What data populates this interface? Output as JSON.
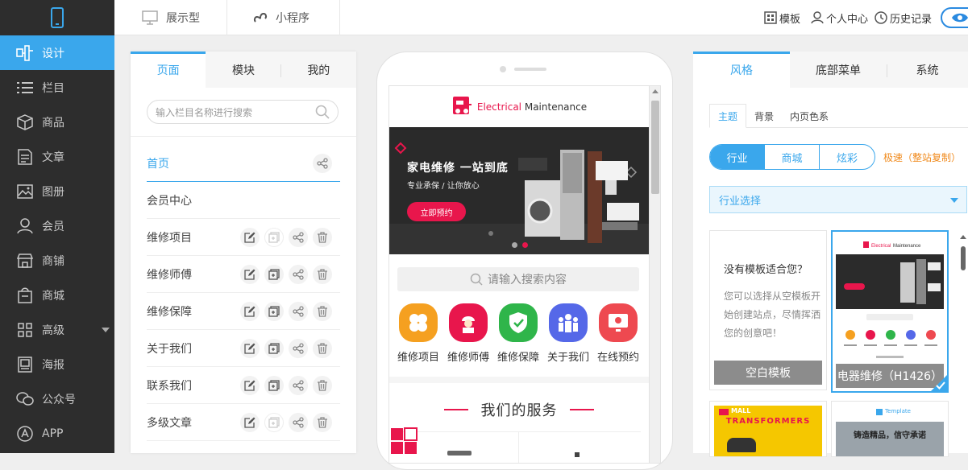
{
  "nav": {
    "items": [
      {
        "label": "设计",
        "icon": "design-icon",
        "active": true
      },
      {
        "label": "栏目",
        "icon": "list-icon"
      },
      {
        "label": "商品",
        "icon": "box-icon"
      },
      {
        "label": "文章",
        "icon": "article-icon"
      },
      {
        "label": "图册",
        "icon": "image-icon"
      },
      {
        "label": "会员",
        "icon": "user-icon"
      },
      {
        "label": "商铺",
        "icon": "shop-icon"
      },
      {
        "label": "商城",
        "icon": "mall-icon"
      },
      {
        "label": "高级",
        "icon": "grid-icon"
      },
      {
        "label": "海报",
        "icon": "poster-icon"
      },
      {
        "label": "公众号",
        "icon": "wechat-icon"
      },
      {
        "label": "APP",
        "icon": "app-icon"
      }
    ]
  },
  "topbar": {
    "tabs": [
      {
        "label": "展示型",
        "icon": "monitor-icon"
      },
      {
        "label": "小程序",
        "icon": "miniprogram-icon"
      }
    ],
    "right": {
      "template": "模板",
      "personal": "个人中心",
      "history": "历史记录"
    }
  },
  "left_panel": {
    "tabs": [
      "页面",
      "模块",
      "我的"
    ],
    "search_placeholder": "输入栏目名称进行搜索",
    "rows": [
      "首页",
      "会员中心",
      "维修项目",
      "维修师傅",
      "维修保障",
      "关于我们",
      "联系我们",
      "多级文章"
    ]
  },
  "phone": {
    "logo_part1": "Electrical",
    "logo_part2": "Maintenance",
    "banner_title": "家电维修  一站到底",
    "banner_sub": "专业承保 / 让你放心",
    "banner_button": "立即预约",
    "search_placeholder": "请输入搜索内容",
    "quick_items": [
      {
        "label": "维修项目",
        "color": "#f5a020"
      },
      {
        "label": "维修师傅",
        "color": "#e8164c"
      },
      {
        "label": "维修保障",
        "color": "#2fb54a"
      },
      {
        "label": "关于我们",
        "color": "#5568e8"
      },
      {
        "label": "在线预约",
        "color": "#ee4950"
      }
    ],
    "section_title": "我们的服务"
  },
  "right_panel": {
    "tabs": [
      "风格",
      "底部菜单",
      "系统"
    ],
    "subtabs": [
      "主题",
      "背景",
      "内页色系"
    ],
    "segments": [
      "行业",
      "商城",
      "炫彩"
    ],
    "quick_copy": "极速（整站复制）",
    "industry_select": "行业选择",
    "blank_card": {
      "question": "没有模板适合您？",
      "desc": "您可以选择从空模板开始创建站点，尽情挥洒您的创意吧！",
      "footer": "空白模板"
    },
    "template_card": {
      "footer": "电器维修（H1426）"
    },
    "card3_text": "TRANSFORMERS",
    "card3_brand": "MALL",
    "card4_brand": "Template",
    "card4_text": "铸造精品，信守承诺"
  }
}
